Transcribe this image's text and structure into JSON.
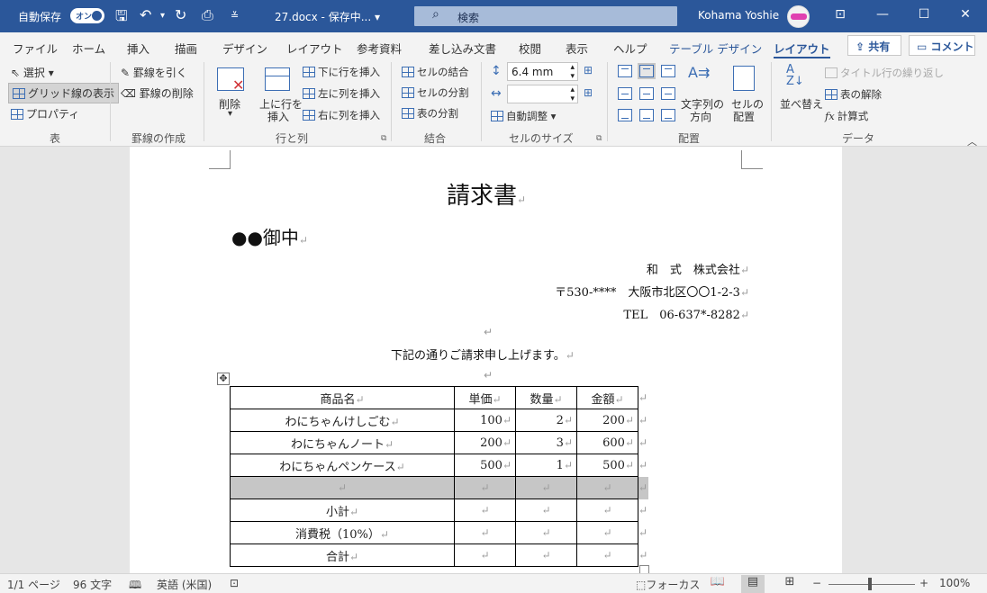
{
  "titlebar": {
    "autosave_label": "自動保存",
    "autosave_state": "オン",
    "doc_title": "27.docx - 保存中... ▾",
    "search_placeholder": "検索",
    "user_name": "Kohama Yoshie",
    "minimize": "—",
    "maximize": "☐",
    "close": "✕",
    "ribbon_display": "⊡"
  },
  "tabs": [
    "ファイル",
    "ホーム",
    "挿入",
    "描画",
    "デザイン",
    "レイアウト",
    "参考資料",
    "差し込み文書",
    "校閲",
    "表示",
    "ヘルプ",
    "テーブル デザイン",
    "レイアウト"
  ],
  "share_label": "共有",
  "comment_label": "コメント",
  "ribbon": {
    "table_group": {
      "select": "選択 ▾",
      "gridlines": "グリッド線の表示",
      "properties": "プロパティ",
      "label": "表"
    },
    "draw_group": {
      "draw_table": "罫線を引く",
      "eraser": "罫線の削除",
      "label": "罫線の作成"
    },
    "rows_group": {
      "delete": "削除",
      "delete_arrow": "▾",
      "insert_above_1": "上に行を",
      "insert_above_2": "挿入",
      "insert_below": "下に行を挿入",
      "insert_left": "左に列を挿入",
      "insert_right": "右に列を挿入",
      "label": "行と列"
    },
    "merge_group": {
      "merge": "セルの結合",
      "split_cells": "セルの分割",
      "split_table": "表の分割",
      "label": "結合"
    },
    "size_group": {
      "height": "6.4 mm",
      "width": "",
      "autofit": "自動調整 ▾",
      "label": "セルのサイズ"
    },
    "align_group": {
      "text_direction_1": "文字列の",
      "text_direction_2": "方向",
      "margins_1": "セルの",
      "margins_2": "配置",
      "label": "配置"
    },
    "data_group": {
      "sort": "並べ替え",
      "repeat_header": "タイトル行の繰り返し",
      "convert": "表の解除",
      "formula": "計算式",
      "label": "データ"
    }
  },
  "document": {
    "title": "請求書",
    "addressee": "●●御中",
    "company": "和　式　株式会社",
    "address": "〒530-****　大阪市北区〇〇1-2-3",
    "tel": "TEL　06-637*-8282",
    "intro": "下記の通りご請求申し上げます。",
    "para_mark": "↵",
    "table": {
      "headers": [
        "商品名",
        "単価",
        "数量",
        "金額"
      ],
      "rows": [
        [
          "わにちゃんけしごむ",
          "100",
          "2",
          "200"
        ],
        [
          "わにちゃんノート",
          "200",
          "3",
          "600"
        ],
        [
          "わにちゃんペンケース",
          "500",
          "1",
          "500"
        ],
        [
          "",
          "",
          "",
          ""
        ],
        [
          "小計",
          "",
          "",
          ""
        ],
        [
          "消費税（10%）",
          "",
          "",
          ""
        ],
        [
          "合計",
          "",
          "",
          ""
        ]
      ]
    }
  },
  "status": {
    "page": "1/1 ページ",
    "words": "96 文字",
    "language": "英語 (米国)",
    "focus": "フォーカス",
    "zoom": "100%",
    "zoom_minus": "−",
    "zoom_plus": "+"
  }
}
